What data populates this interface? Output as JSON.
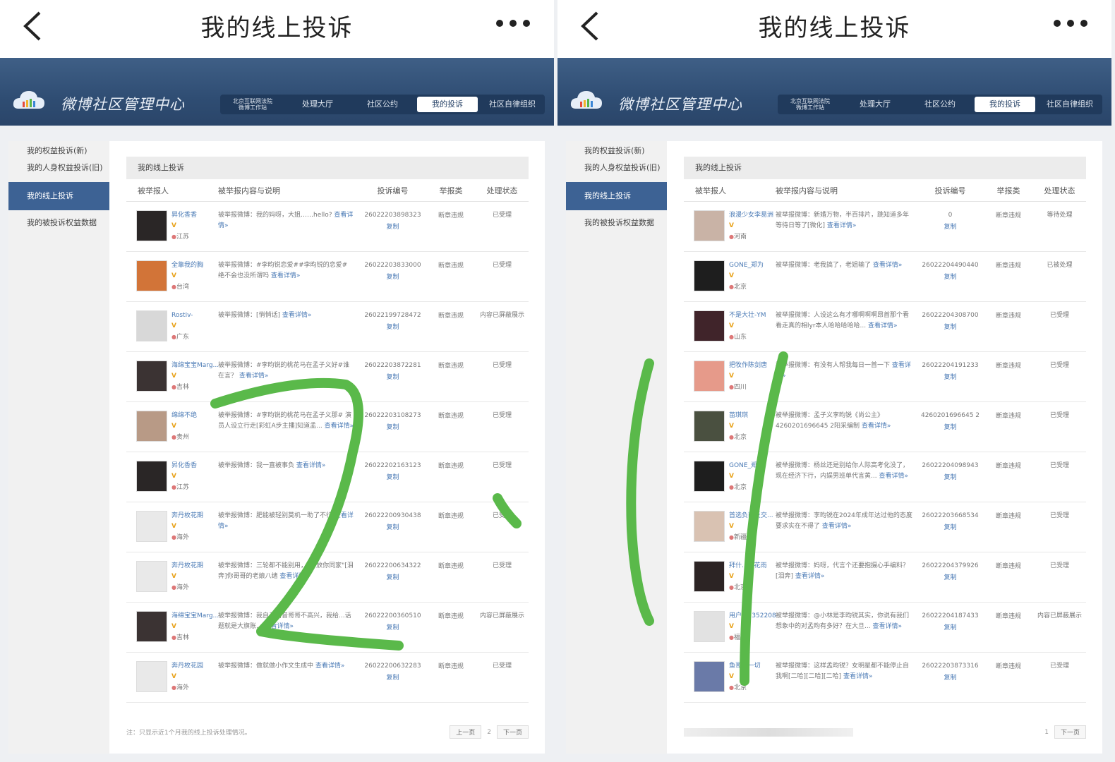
{
  "left": {
    "page_title": "我的线上投诉",
    "site_name": "微博社区管理中心",
    "nav": [
      {
        "label": "北京互联网法院\n微博工作站",
        "small": true,
        "active": false
      },
      {
        "label": "处理大厅",
        "active": false
      },
      {
        "label": "社区公约",
        "active": false
      },
      {
        "label": "我的投诉",
        "active": true
      },
      {
        "label": "社区自律组织",
        "active": false
      }
    ],
    "sidebar": [
      "我的权益投诉(新)",
      "我的人身权益投诉(旧)",
      "我的线上投诉",
      "我的被投诉权益数据"
    ],
    "sidebar_active": 2,
    "section_title": "我的线上投诉",
    "columns": [
      "被举报人",
      "被举报内容与说明",
      "投诉编号",
      "举报类",
      "处理状态"
    ],
    "rows": [
      {
        "user": "昇化香香",
        "loc": "江苏",
        "desc": "被举报微博：我的妈呀，大姐……hello?",
        "more": "查看详情»",
        "id": "26022203898323",
        "copy": "复制",
        "type": "断章违规",
        "status": "已受理",
        "avatar": "#2a2626"
      },
      {
        "user": "全靠我的胸",
        "loc": "台湾",
        "desc": "被举报微博：#李昀锐恋爱##李昀锐的恋爱# 绝不会也没所谓吗",
        "more": "查看详情»",
        "id": "26022203833000",
        "copy": "复制",
        "type": "断章违规",
        "status": "已受理",
        "avatar": "#d27438"
      },
      {
        "user": "Rostiv-",
        "loc": "广东",
        "desc": "被举报微博：[悄悄话]",
        "more": "查看详情»",
        "id": "26022199728472",
        "copy": "复制",
        "type": "断章违规",
        "status": "内容已屏蔽展示",
        "avatar": "#d8d8d8"
      },
      {
        "user": "海绵宝宝Marg...",
        "loc": "吉林",
        "desc": "被举报微博：#李昀锐的桃花马在孟子义好#谁在言？",
        "more": "查看详情»",
        "id": "26022203872281",
        "copy": "复制",
        "type": "断章违规",
        "status": "已受理",
        "avatar": "#3b3333"
      },
      {
        "user": "绵绵不绝",
        "loc": "贵州",
        "desc": "被举报微博：#李昀锐的桃花马在孟子义那# 演员人设立行走[彩虹A步主播]知道孟...",
        "more": "查看详情»",
        "id": "26022203108273",
        "copy": "复制",
        "type": "断章违规",
        "status": "已受理",
        "avatar": "#b89a86"
      },
      {
        "user": "昇化香香",
        "loc": "江苏",
        "desc": "被举报微博：我一直被事负",
        "more": "查看详情»",
        "id": "26022202163123",
        "copy": "复制",
        "type": "断章违规",
        "status": "已受理",
        "avatar": "#2a2626"
      },
      {
        "user": "奔丹枚花期",
        "loc": "海外",
        "desc": "被举报微博：肥能被轻别莫机一助了不行",
        "more": "查看详情»",
        "id": "26022200930438",
        "copy": "复制",
        "type": "断章违规",
        "status": "已受理",
        "avatar": "#e9e9e9"
      },
      {
        "user": "奔丹枚花期",
        "loc": "海外",
        "desc": "被举报微博：三轮都不能别用，还\"放你同家\"[泪奔]你哥哥的老娘八绪",
        "more": "查看详情»",
        "id": "26022200634322",
        "copy": "复制",
        "type": "断章违规",
        "status": "已受理",
        "avatar": "#e9e9e9"
      },
      {
        "user": "海绵宝宝Marg...",
        "loc": "吉林",
        "desc": "被举报微博：我自己语音哥哥不高兴，我给...话题就是大旗账...",
        "more": "查看详情»",
        "id": "26022200360510",
        "copy": "复制",
        "type": "断章违规",
        "status": "内容已屏蔽展示",
        "avatar": "#3b3333"
      },
      {
        "user": "奔丹枚花园",
        "loc": "海外",
        "desc": "被举报微博：做就做小作文生成中",
        "more": "查看详情»",
        "id": "26022200632283",
        "copy": "复制",
        "type": "断章违规",
        "status": "已受理",
        "avatar": "#e9e9e9"
      }
    ],
    "footnote": "注：只显示近1个月我的线上投诉处理情况。",
    "pager": {
      "prev": "上一页",
      "page": "2",
      "next": "下一页"
    }
  },
  "right": {
    "page_title": "我的线上投诉",
    "site_name": "微博社区管理中心",
    "nav": [
      {
        "label": "北京互联网法院\n微博工作站",
        "small": true,
        "active": false
      },
      {
        "label": "处理大厅",
        "active": false
      },
      {
        "label": "社区公约",
        "active": false
      },
      {
        "label": "我的投诉",
        "active": true
      },
      {
        "label": "社区自律组织",
        "active": false
      }
    ],
    "sidebar": [
      "我的权益投诉(新)",
      "我的人身权益投诉(旧)",
      "我的线上投诉",
      "我的被投诉权益数据"
    ],
    "sidebar_active": 2,
    "section_title": "我的线上投诉",
    "columns": [
      "被举报人",
      "被举报内容与说明",
      "投诉编号",
      "举报类",
      "处理状态"
    ],
    "rows": [
      {
        "user": "浪漫少女李易洲",
        "loc": "河南",
        "desc": "被举报微博：新婚万物，半百排片，跳知道多年等待日等了[微化]",
        "more": "查看详情»",
        "id": "0",
        "copy": "复制",
        "type": "断章违规",
        "status": "等待处理",
        "avatar": "#c9b3a6"
      },
      {
        "user": "GONE_郑为",
        "loc": "北京",
        "desc": "被举报微博：老我搞了，老姐输了",
        "more": "查看详情»",
        "id": "26022204490440",
        "copy": "复制",
        "type": "断章违规",
        "status": "已被处理",
        "avatar": "#1e1e1e"
      },
      {
        "user": "不是大壮-YM",
        "loc": "山东",
        "desc": "被举报微博：人设这么有才哪啊啊啊昂首那个看看走真的相lyr本人哈哈哈哈哈...",
        "more": "查看详情»",
        "id": "26022204308700",
        "copy": "复制",
        "type": "断章违规",
        "status": "已受理",
        "avatar": "#40242a"
      },
      {
        "user": "把牧作陈剑唐",
        "loc": "四川",
        "desc": "被举报微博：有没有人帮我每日一首一下",
        "more": "查看详情»",
        "id": "26022204191233",
        "copy": "复制",
        "type": "断章违规",
        "status": "已受理",
        "avatar": "#e69a8a"
      },
      {
        "user": "苗琪琪",
        "loc": "北京",
        "desc": "被举报微博：孟子义李昀锐《尚公主》4260201696645 2阳采编制",
        "more": "查看详情»",
        "id": "4260201696645 2",
        "copy": "复制",
        "type": "断章违规",
        "status": "已受理",
        "avatar": "#4a5040"
      },
      {
        "user": "GONE_郑为",
        "loc": "北京",
        "desc": "被举报微博：杨丝还是别给你人际高考化没了，现在经济下行，内娱男班单代言黄...",
        "more": "查看详情»",
        "id": "26022204098943",
        "copy": "复制",
        "type": "断章违规",
        "status": "已受理",
        "avatar": "#1e1e1e"
      },
      {
        "user": "首选负面反交...",
        "loc": "新疆",
        "desc": "被举报微博：李昀锐在2024年成年达过他的态度要求实在不得了",
        "more": "查看详情»",
        "id": "26022203668534",
        "copy": "复制",
        "type": "断章违规",
        "status": "已受理",
        "avatar": "#d9c2b2"
      },
      {
        "user": "拜什...开花雨",
        "loc": "北京",
        "desc": "被举报微博：妈呀，代言个还要抱摄心手编料？[泪奔]",
        "more": "查看详情»",
        "id": "26022204379926",
        "copy": "复制",
        "type": "断章违规",
        "status": "已受理",
        "avatar": "#2c2424"
      },
      {
        "user": "用户...1352208",
        "loc": "福州",
        "desc": "被举报微博：@小林是李昀锐其实，你说有我们想象中的对孟昀有多好？在大旦...",
        "more": "查看详情»",
        "id": "26022204187433",
        "copy": "复制",
        "type": "断章违规",
        "status": "内容已屏蔽展示",
        "avatar": "#e2e2e2"
      },
      {
        "user": "鱼哥...一切",
        "loc": "北京",
        "desc": "被举报微博：这样孟昀锐？女明星都不能停止自我啊[二哈][二哈][二哈]",
        "more": "查看详情»",
        "id": "26022203873316",
        "copy": "复制",
        "type": "断章违规",
        "status": "已受理",
        "avatar": "#6a7aa8"
      }
    ],
    "footnote": "",
    "pager": {
      "prev": "",
      "page": "1",
      "next": "下一页"
    }
  },
  "colors": {
    "banner": "#2f4d73",
    "nav_bg": "#203a5c",
    "side_active": "#3d6294",
    "link": "#4a7ab5",
    "marker": "#5ab94a"
  },
  "icons": [
    "back-chevron-icon",
    "more-dots-icon",
    "cloud-logo-icon"
  ]
}
